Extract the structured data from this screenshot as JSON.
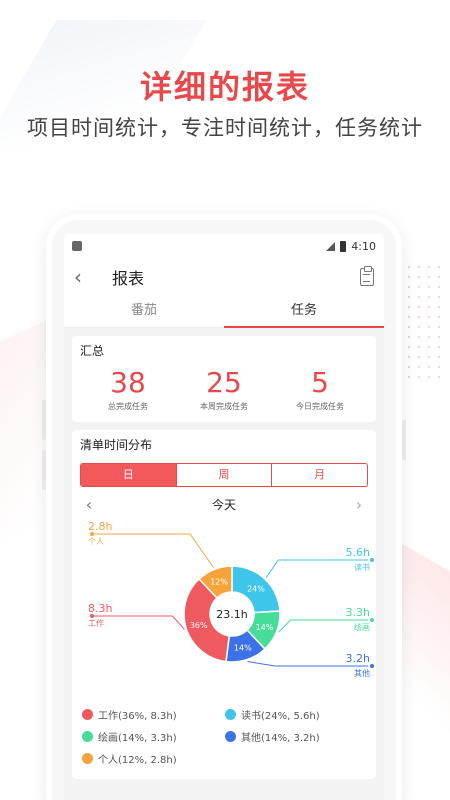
{
  "headline": "详细的报表",
  "subline": "项目时间统计，专注时间统计，任务统计",
  "status": {
    "time": "4:10"
  },
  "appbar": {
    "title": "报表"
  },
  "tabs": [
    {
      "label": "番茄"
    },
    {
      "label": "任务"
    }
  ],
  "summary": {
    "title": "汇总",
    "items": [
      {
        "value": "38",
        "label": "总完成任务"
      },
      {
        "value": "25",
        "label": "本周完成任务"
      },
      {
        "value": "5",
        "label": "今日完成任务"
      }
    ]
  },
  "distribution": {
    "title": "清单时间分布",
    "segments": [
      {
        "label": "日"
      },
      {
        "label": "周"
      },
      {
        "label": "月"
      }
    ],
    "date_label": "今天",
    "center_label": "23.1h",
    "legend": [
      {
        "text": "工作(36%, 8.3h)",
        "color": "#ee5a60"
      },
      {
        "text": "读书(24%, 5.6h)",
        "color": "#3ec6ea"
      },
      {
        "text": "绘画(14%, 3.3h)",
        "color": "#45dd98"
      },
      {
        "text": "其他(14%, 3.2h)",
        "color": "#3d72e6"
      },
      {
        "text": "个人(12%, 2.8h)",
        "color": "#f5a43b"
      }
    ]
  },
  "chart_data": {
    "type": "pie",
    "title": "",
    "center": "23.1h",
    "slices": [
      {
        "name": "读书",
        "percent": 24,
        "hours": 5.6,
        "hours_label": "5.6h",
        "pct_label": "24%",
        "color": "#3ec6ea"
      },
      {
        "name": "绘画",
        "percent": 14,
        "hours": 3.3,
        "hours_label": "3.3h",
        "pct_label": "14%",
        "color": "#45dd98"
      },
      {
        "name": "其他",
        "percent": 14,
        "hours": 3.2,
        "hours_label": "3.2h",
        "pct_label": "14%",
        "color": "#3d72e6"
      },
      {
        "name": "工作",
        "percent": 36,
        "hours": 8.3,
        "hours_label": "8.3h",
        "pct_label": "36%",
        "color": "#ee5a60"
      },
      {
        "name": "个人",
        "percent": 12,
        "hours": 2.8,
        "hours_label": "2.8h",
        "pct_label": "12%",
        "color": "#f5a43b"
      }
    ]
  },
  "colors": {
    "accent": "#e8484a"
  }
}
